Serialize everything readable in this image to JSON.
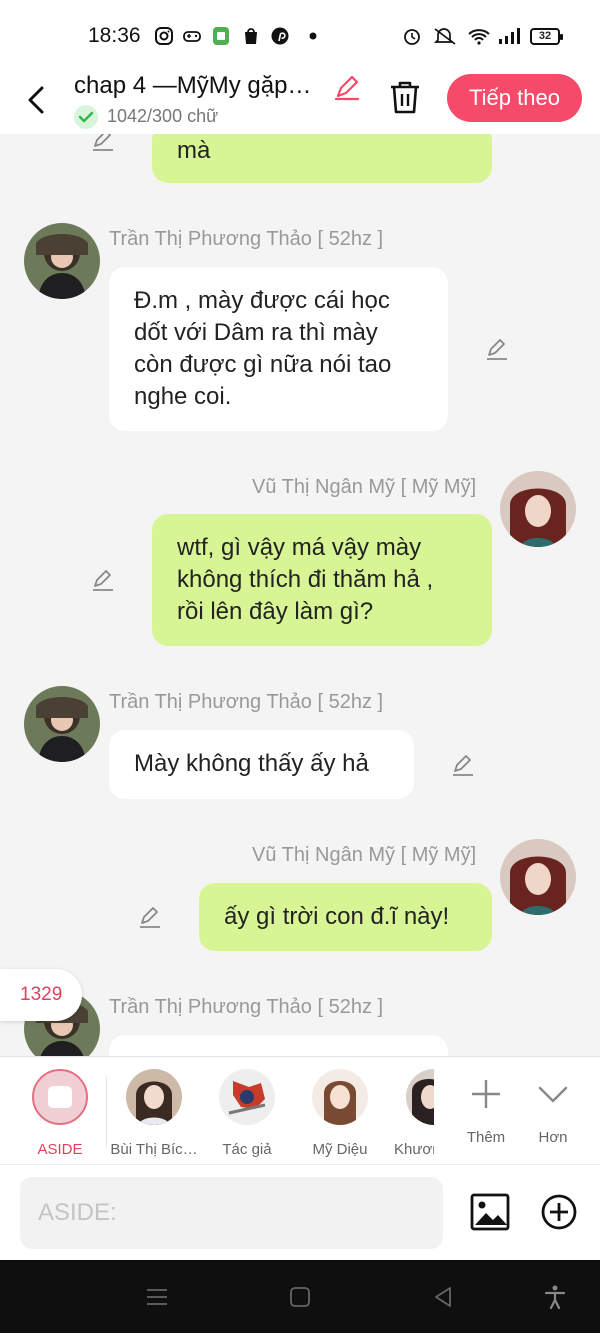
{
  "status_bar": {
    "time": "18:36",
    "battery": "32"
  },
  "header": {
    "title": "chap 4 —MỹMy gặp…",
    "word_count": "1042/300 chữ",
    "next_label": "Tiếp theo"
  },
  "messages": [
    {
      "side": "right",
      "text": "mà"
    },
    {
      "side": "left",
      "sender": "Trần Thị Phương Thảo [ 52hz ]",
      "lines": [
        "Đ.m , mày được cái học",
        "dốt với Dâm ra thì mày",
        "còn được gì nữa nói tao",
        "nghe coi."
      ]
    },
    {
      "side": "right",
      "sender": "Vũ Thị Ngân Mỹ [ Mỹ Mỹ]",
      "lines": [
        "wtf, gì vậy má vậy mày",
        "không thích đi thăm hả ,",
        "rồi lên đây làm gì?"
      ]
    },
    {
      "side": "left",
      "sender": "Trần Thị Phương Thảo [ 52hz ]",
      "text": "Mày không thấy ấy hả"
    },
    {
      "side": "right",
      "sender": "Vũ Thị Ngân Mỹ [ Mỹ Mỹ]",
      "text": "ấy gì trời con đ.ĩ này!"
    },
    {
      "side": "left",
      "sender": "Trần Thị Phương Thảo [ 52hz ]"
    }
  ],
  "counter": "1329",
  "characters": [
    {
      "label": "ASIDE",
      "active": true
    },
    {
      "label": "Bùi Thị Bíc…"
    },
    {
      "label": "Tác giả"
    },
    {
      "label": "Mỹ Diệu"
    },
    {
      "label": "Khươn"
    },
    {
      "label": "Thêm"
    },
    {
      "label": "Hơn"
    }
  ],
  "input": {
    "placeholder": "ASIDE:"
  },
  "colors": {
    "accent": "#f54a6a",
    "green_bubble": "#d8f596",
    "aside_label": "#e0405e"
  }
}
